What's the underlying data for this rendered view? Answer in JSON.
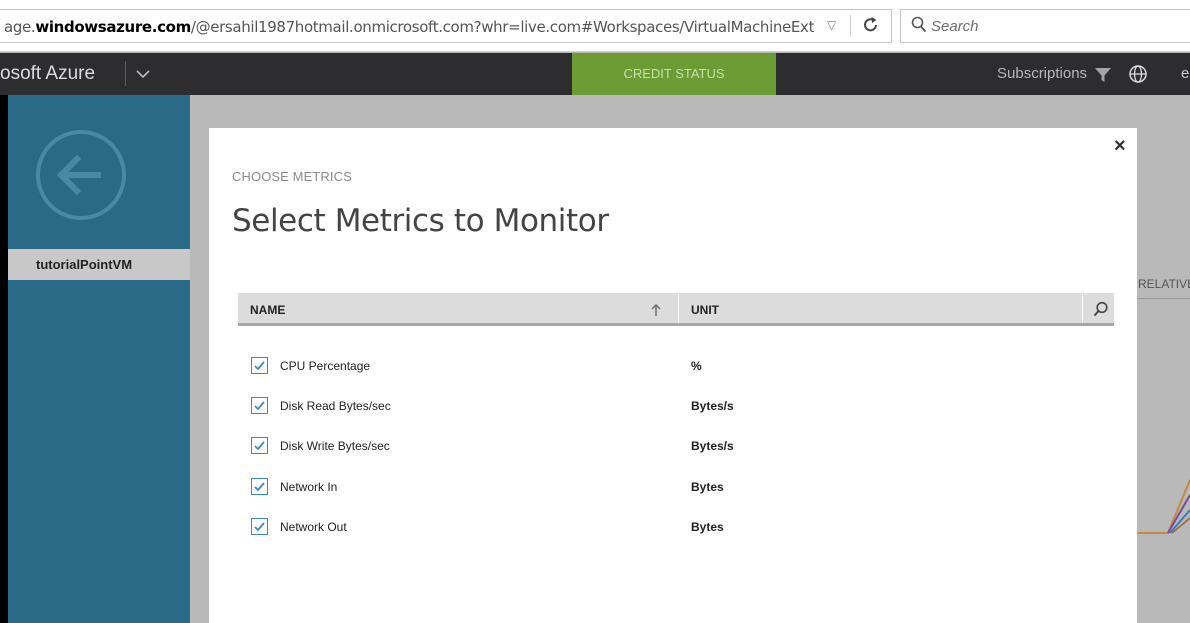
{
  "browser": {
    "url_prefix": "age.",
    "url_domain": "windowsazure.com",
    "url_rest": "/@ersahil1987hotmail.onmicrosoft.com?whr=live.com#Workspaces/VirtualMachineExtension/Virt",
    "search_placeholder": "Search"
  },
  "topbar": {
    "brand": "osoft Azure",
    "credit_status": "CREDIT STATUS",
    "subscriptions": "Subscriptions",
    "language": "en"
  },
  "sidebar": {
    "vm_name": "tutorialPointVM"
  },
  "background": {
    "relative_label": "RELATIVE"
  },
  "modal": {
    "close": "×",
    "overline": "CHOOSE METRICS",
    "title": "Select Metrics to Monitor",
    "columns": {
      "name": "NAME",
      "unit": "UNIT"
    },
    "metrics": [
      {
        "name": "CPU Percentage",
        "unit": "%",
        "checked": true
      },
      {
        "name": "Disk Read Bytes/sec",
        "unit": "Bytes/s",
        "checked": true
      },
      {
        "name": "Disk Write Bytes/sec",
        "unit": "Bytes/s",
        "checked": true
      },
      {
        "name": "Network In",
        "unit": "Bytes",
        "checked": true
      },
      {
        "name": "Network Out",
        "unit": "Bytes",
        "checked": true
      }
    ]
  },
  "colors": {
    "azure_topbar": "#2d2d30",
    "credit_green": "#6c9c33",
    "sidebar_blue": "#2a6a86",
    "checkbox_blue": "#3b88c4"
  }
}
